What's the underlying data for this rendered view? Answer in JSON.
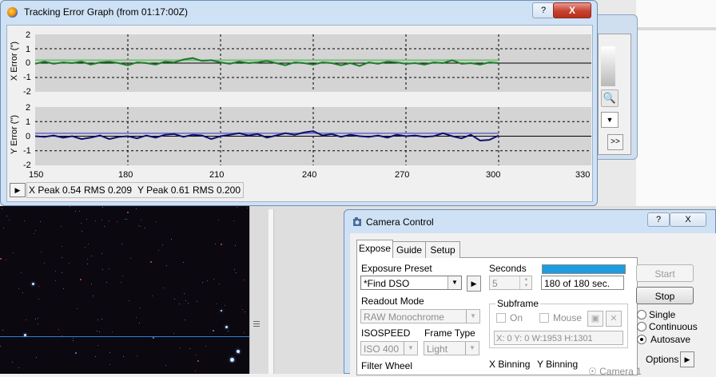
{
  "tracking_window": {
    "title": "Tracking Error Graph (from 01:17:00Z)",
    "help_label": "?",
    "close_label": "X",
    "x_axis_label": "X Error (\")",
    "y_axis_label": "Y Error (\")",
    "y_ticks": [
      "2",
      "1",
      "0",
      "-1",
      "-2"
    ],
    "x_ticks": [
      "150",
      "180",
      "210",
      "240",
      "270",
      "300",
      "330"
    ],
    "status": {
      "x_peak": "X Peak 0.54",
      "x_rms": "RMS 0.209",
      "y_peak": "Y Peak 0.61",
      "y_rms": "RMS 0.200"
    },
    "colors": {
      "x_series": "#1d7a2a",
      "x_ref": "#7bbf7b",
      "y_series": "#101070",
      "y_ref": "#8080c8",
      "plot_bg": "#d4d4d4"
    }
  },
  "chart_data": [
    {
      "type": "line",
      "ylabel": "X Error (\")",
      "xlim": [
        150,
        330
      ],
      "ylim": [
        -2,
        2
      ],
      "grid": true,
      "series": [
        {
          "x": [
            150,
            153,
            156,
            159,
            162,
            165,
            168,
            171,
            174,
            177,
            180,
            183,
            186,
            189,
            192,
            195,
            198,
            201,
            204,
            207,
            210,
            213,
            216,
            219,
            222,
            225,
            228,
            231,
            234,
            237,
            240,
            243,
            246,
            249,
            252,
            255,
            258,
            261,
            264,
            267,
            270,
            273,
            276,
            279,
            282,
            285,
            288,
            291,
            294,
            297,
            300
          ],
          "values": [
            -0.05,
            0.1,
            -0.05,
            0.05,
            0.0,
            0.1,
            -0.1,
            0.05,
            0.1,
            0.0,
            -0.15,
            0.05,
            0.0,
            -0.1,
            0.1,
            0.05,
            0.25,
            0.35,
            0.15,
            0.2,
            0.05,
            -0.05,
            0.1,
            0.0,
            0.05,
            0.15,
            0.0,
            -0.15,
            0.05,
            0.0,
            -0.1,
            0.05,
            0.0,
            -0.15,
            0.0,
            -0.2,
            0.05,
            -0.05,
            0.1,
            0.05,
            -0.05,
            0.0,
            -0.1,
            0.05,
            0.0,
            0.2,
            -0.05,
            0.0,
            -0.1,
            0.05,
            0.0
          ]
        }
      ]
    },
    {
      "type": "line",
      "ylabel": "Y Error (\")",
      "xlim": [
        150,
        330
      ],
      "ylim": [
        -2,
        2
      ],
      "grid": true,
      "series": [
        {
          "x": [
            150,
            153,
            156,
            159,
            162,
            165,
            168,
            171,
            174,
            177,
            180,
            183,
            186,
            189,
            192,
            195,
            198,
            201,
            204,
            207,
            210,
            213,
            216,
            219,
            222,
            225,
            228,
            231,
            234,
            237,
            240,
            243,
            246,
            249,
            252,
            255,
            258,
            261,
            264,
            267,
            270,
            273,
            276,
            279,
            282,
            285,
            288,
            291,
            294,
            297,
            300
          ],
          "values": [
            0.0,
            -0.05,
            0.05,
            -0.1,
            0.0,
            -0.2,
            -0.1,
            0.05,
            -0.2,
            -0.05,
            0.0,
            -0.15,
            0.05,
            -0.1,
            0.1,
            0.15,
            -0.05,
            0.1,
            0.05,
            -0.2,
            0.0,
            0.1,
            0.2,
            0.05,
            0.15,
            -0.1,
            0.05,
            0.2,
            0.1,
            0.25,
            0.35,
            0.05,
            0.15,
            -0.05,
            0.1,
            0.0,
            -0.05,
            0.05,
            -0.1,
            0.1,
            0.0,
            0.05,
            -0.05,
            0.0,
            0.2,
            0.0,
            -0.15,
            0.1,
            -0.3,
            -0.25,
            0.05
          ]
        }
      ]
    }
  ],
  "camera_window": {
    "title": "Camera Control",
    "help_label": "?",
    "close_label": "X",
    "tabs": [
      {
        "label": "Expose",
        "active": true
      },
      {
        "label": "Guide",
        "active": false
      },
      {
        "label": "Setup",
        "active": false
      }
    ],
    "exposure_preset_label": "Exposure Preset",
    "exposure_preset_value": "*Find DSO",
    "seconds_label": "Seconds",
    "seconds_value": "5",
    "progress_fraction": 1.0,
    "progress_text": "180 of 180 sec.",
    "readout_mode_label": "Readout Mode",
    "readout_mode_value": "RAW Monochrome",
    "subframe_label": "Subframe",
    "subframe_on_label": "On",
    "subframe_mouse_label": "Mouse",
    "subframe_readout": "X:   0 Y:   0 W:1953 H:1301",
    "isospeed_label": "ISOSPEED",
    "isospeed_value": "ISO 400",
    "frame_type_label": "Frame Type",
    "frame_type_value": "Light",
    "filter_wheel_label": "Filter Wheel",
    "x_binning_label": "X Binning",
    "y_binning_label": "Y Binning",
    "camera_label": "Camera 1",
    "start_label": "Start",
    "stop_label": "Stop",
    "mode_options": [
      {
        "label": "Single",
        "selected": false
      },
      {
        "label": "Continuous",
        "selected": false
      },
      {
        "label": "Autosave",
        "selected": true
      }
    ],
    "options_label": "Options"
  },
  "background": {
    "splitter_grip": "grip-icon",
    "back_window_next": ">>"
  }
}
